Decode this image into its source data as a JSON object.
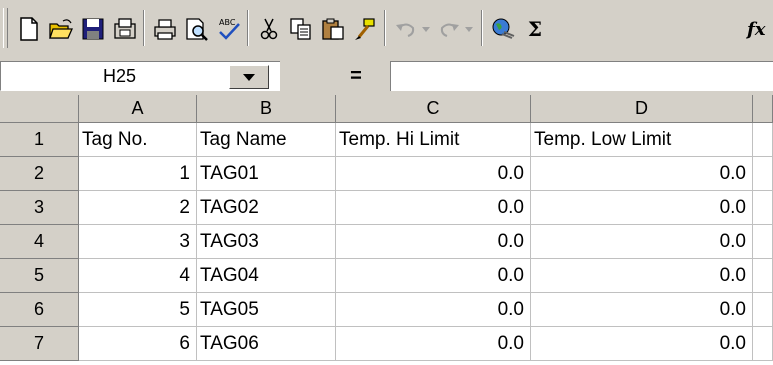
{
  "toolbar": {
    "buttons": [
      {
        "name": "new-icon"
      },
      {
        "name": "open-icon"
      },
      {
        "name": "save-icon"
      },
      {
        "name": "permission-icon"
      },
      {
        "name": "print-icon"
      },
      {
        "name": "print-preview-icon"
      },
      {
        "name": "spelling-icon"
      },
      {
        "name": "cut-icon"
      },
      {
        "name": "copy-icon"
      },
      {
        "name": "paste-icon"
      },
      {
        "name": "format-painter-icon"
      },
      {
        "name": "undo-icon"
      },
      {
        "name": "redo-icon"
      },
      {
        "name": "hyperlink-icon"
      },
      {
        "name": "autosum-icon"
      },
      {
        "name": "function-icon"
      }
    ],
    "sigma": "Σ",
    "fx": "fx"
  },
  "formula_bar": {
    "name_box": "H25",
    "equals": "=",
    "formula": ""
  },
  "sheet": {
    "columns": [
      "A",
      "B",
      "C",
      "D"
    ],
    "rows": [
      {
        "row": "1",
        "cells": [
          "Tag No.",
          "Tag Name",
          "Temp. Hi Limit",
          "Temp. Low Limit"
        ]
      },
      {
        "row": "2",
        "cells": [
          "1",
          "TAG01",
          "0.0",
          "0.0"
        ]
      },
      {
        "row": "3",
        "cells": [
          "2",
          "TAG02",
          "0.0",
          "0.0"
        ]
      },
      {
        "row": "4",
        "cells": [
          "3",
          "TAG03",
          "0.0",
          "0.0"
        ]
      },
      {
        "row": "5",
        "cells": [
          "4",
          "TAG04",
          "0.0",
          "0.0"
        ]
      },
      {
        "row": "6",
        "cells": [
          "5",
          "TAG05",
          "0.0",
          "0.0"
        ]
      },
      {
        "row": "7",
        "cells": [
          "6",
          "TAG06",
          "0.0",
          "0.0"
        ]
      }
    ]
  },
  "colors": {
    "chrome": "#d4d0c8",
    "gridline": "#c0c0c0"
  }
}
